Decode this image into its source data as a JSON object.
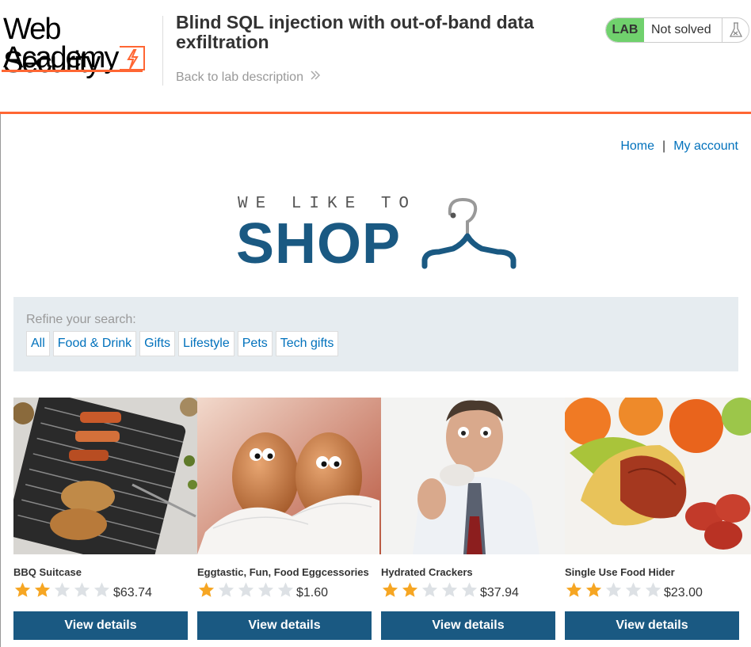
{
  "header": {
    "logo_line1": "Web Security",
    "logo_line2": "Academy",
    "title": "Blind SQL injection with out-of-band data exfiltration",
    "back_link": "Back to lab description",
    "lab_badge": "LAB",
    "lab_status": "Not solved"
  },
  "nav": {
    "home": "Home",
    "separator": "|",
    "account": "My account"
  },
  "banner": {
    "tagline": "WE LIKE TO",
    "shop": "SHOP"
  },
  "filter": {
    "label": "Refine your search:",
    "tags": [
      "All",
      "Food & Drink",
      "Gifts",
      "Lifestyle",
      "Pets",
      "Tech gifts"
    ]
  },
  "colors": {
    "accent_orange": "#ff6633",
    "brand_blue": "#1a5982",
    "link_blue": "#0071bc",
    "lab_green": "#70d16d",
    "star_gold": "#f6a623",
    "star_gray": "#dde1e5"
  },
  "products": [
    {
      "name": "BBQ Suitcase",
      "stars": 2,
      "price": "$63.74",
      "button": "View details",
      "image": "bbq-grill-image"
    },
    {
      "name": "Eggtastic, Fun, Food Eggcessories",
      "stars": 1,
      "price": "$1.60",
      "button": "View details",
      "image": "eggs-feather-image"
    },
    {
      "name": "Hydrated Crackers",
      "stars": 2,
      "price": "$37.94",
      "button": "View details",
      "image": "man-eating-cracker-image"
    },
    {
      "name": "Single Use Food Hider",
      "stars": 2,
      "price": "$23.00",
      "button": "View details",
      "image": "food-hider-image"
    }
  ]
}
